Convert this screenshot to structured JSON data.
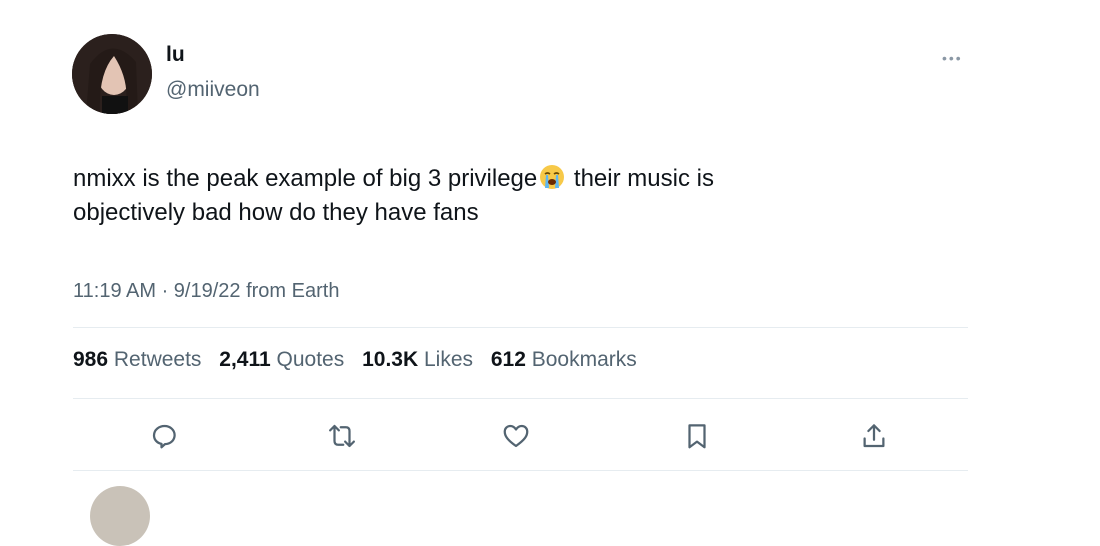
{
  "tweet": {
    "display_name": "lu",
    "handle": "@miiveon",
    "text_before_emoji": "nmixx is the peak example of big 3 privilege",
    "emoji_icon": "loudly-crying-face-icon",
    "text_after_emoji": " their music is",
    "text_line2": "objectively bad how do they have fans",
    "timestamp": "11:19 AM · 9/19/22 from Earth"
  },
  "stats": {
    "retweets_count": "986",
    "retweets_label": "Retweets",
    "quotes_count": "2,411",
    "quotes_label": "Quotes",
    "likes_count": "10.3K",
    "likes_label": "Likes",
    "bookmarks_count": "612",
    "bookmarks_label": "Bookmarks"
  },
  "actions": [
    "reply-icon",
    "retweet-icon",
    "like-icon",
    "bookmark-icon",
    "share-icon"
  ],
  "colors": {
    "text": "#0f1419",
    "secondary": "#536471",
    "divider": "#e6ecf0"
  }
}
